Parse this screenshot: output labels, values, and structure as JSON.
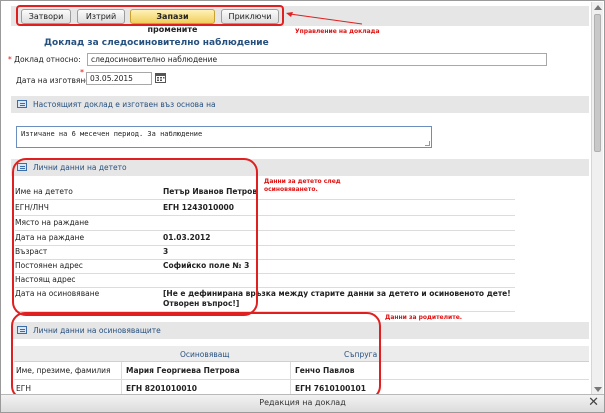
{
  "toolbar": {
    "close_label": "Затвори",
    "delete_label": "Изтрий",
    "save_label": "Запази промените",
    "finish_label": "Приключи"
  },
  "annotations": {
    "toolbar_note": "Управление на доклада",
    "child_note_line1": "Данни за детето след",
    "child_note_line2": "осиновяването.",
    "parent_note": "Данни за родителите."
  },
  "report": {
    "title": "Доклад за следосиновително наблюдение",
    "subject_label": "Доклад относно:",
    "subject_value": "следосиновително наблюдение",
    "date_label": "Дата на изготвяне:",
    "date_value": "03.05.2015"
  },
  "basis_section": {
    "title": "Настоящият доклад е изготвен въз основа на",
    "text": "Изтичане на 6 месечен период. За наблюдение"
  },
  "child_section": {
    "title": "Лични данни на детето",
    "rows": [
      {
        "label": "Име на детето",
        "value": "Петър Иванов Петров"
      },
      {
        "label": "ЕГН/ЛНЧ",
        "value": "ЕГН 1243010000"
      },
      {
        "label": "Място на раждане",
        "value": ""
      },
      {
        "label": "Дата на раждане",
        "value": "01.03.2012"
      },
      {
        "label": "Възраст",
        "value": "3"
      },
      {
        "label": "Постоянен адрес",
        "value": "Софийско поле № 3"
      },
      {
        "label": "Настоящ адрес",
        "value": ""
      },
      {
        "label": "Дата на осиновяване",
        "value": "[Не е дефинирана връзка между старите данни за детето и осиновеното дете! Отворен въпрос!]"
      }
    ]
  },
  "parent_section": {
    "title": "Лични данни на осиновяващите",
    "col_adopter": "Осиновяващ",
    "col_spouse": "Съпруга",
    "rows": [
      {
        "label": "Име, презиме, фамилия",
        "adopter": "Мария Георгиева Петрова",
        "spouse": "Генчо Павлов"
      },
      {
        "label": "ЕГН",
        "adopter": "ЕГН 8201010010",
        "spouse": "ЕГН 7610100101"
      }
    ]
  },
  "window": {
    "title": "Редакция на доклад"
  },
  "icons": {
    "calendar": "calendar-icon",
    "section": "form-icon",
    "close": "close-icon"
  },
  "colors": {
    "annotation": "#e02020",
    "heading": "#26507e",
    "primary_button": "#f1cf5c"
  }
}
